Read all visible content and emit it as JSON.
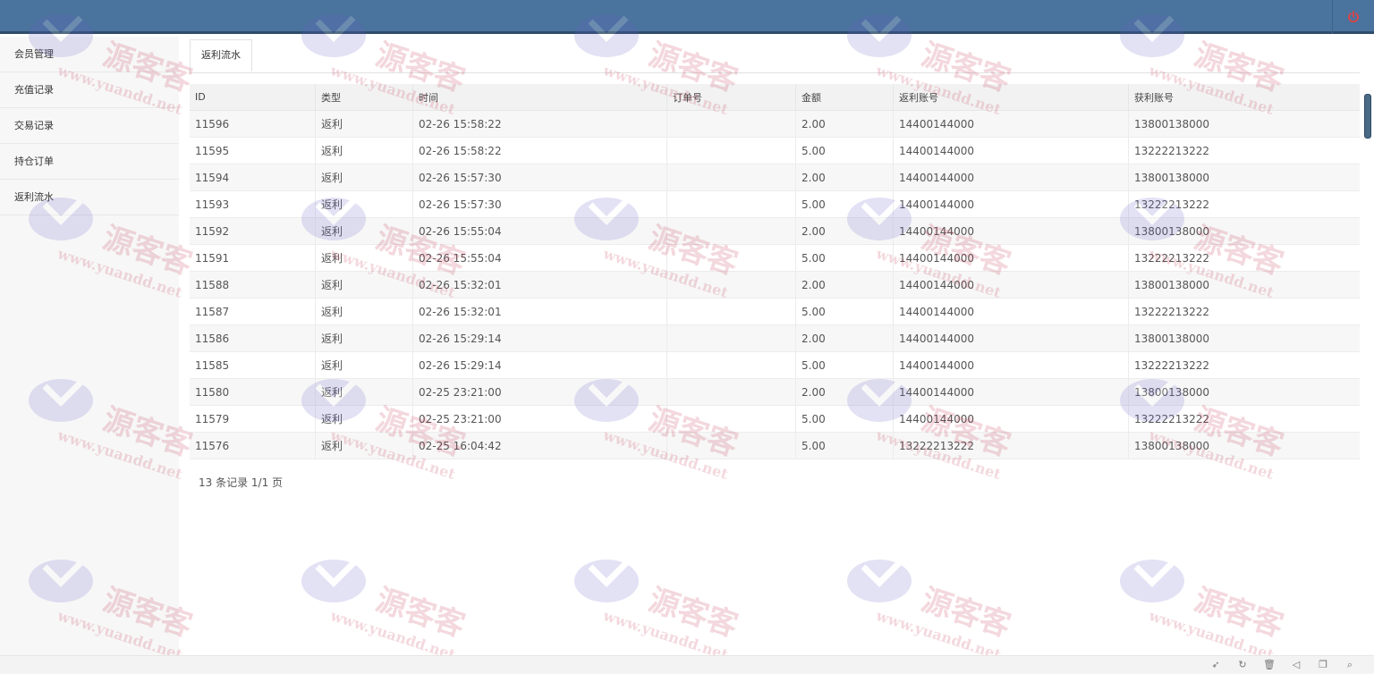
{
  "header": {
    "power_icon": "power-icon",
    "accent": "#4a739e"
  },
  "sidebar": {
    "items": [
      {
        "label": "会员管理"
      },
      {
        "label": "充值记录"
      },
      {
        "label": "交易记录"
      },
      {
        "label": "持仓订单"
      },
      {
        "label": "返利流水"
      }
    ]
  },
  "tabs": [
    {
      "label": "返利流水"
    }
  ],
  "table": {
    "columns": [
      "ID",
      "类型",
      "时间",
      "订单号",
      "金额",
      "返利账号",
      "获利账号"
    ],
    "rows": [
      {
        "id": "11596",
        "type": "返利",
        "time": "02-26 15:58:22",
        "order": "",
        "amount": "2.00",
        "rebate_account": "14400144000",
        "profit_account": "13800138000"
      },
      {
        "id": "11595",
        "type": "返利",
        "time": "02-26 15:58:22",
        "order": "",
        "amount": "5.00",
        "rebate_account": "14400144000",
        "profit_account": "13222213222"
      },
      {
        "id": "11594",
        "type": "返利",
        "time": "02-26 15:57:30",
        "order": "",
        "amount": "2.00",
        "rebate_account": "14400144000",
        "profit_account": "13800138000"
      },
      {
        "id": "11593",
        "type": "返利",
        "time": "02-26 15:57:30",
        "order": "",
        "amount": "5.00",
        "rebate_account": "14400144000",
        "profit_account": "13222213222"
      },
      {
        "id": "11592",
        "type": "返利",
        "time": "02-26 15:55:04",
        "order": "",
        "amount": "2.00",
        "rebate_account": "14400144000",
        "profit_account": "13800138000"
      },
      {
        "id": "11591",
        "type": "返利",
        "time": "02-26 15:55:04",
        "order": "",
        "amount": "5.00",
        "rebate_account": "14400144000",
        "profit_account": "13222213222"
      },
      {
        "id": "11588",
        "type": "返利",
        "time": "02-26 15:32:01",
        "order": "",
        "amount": "2.00",
        "rebate_account": "14400144000",
        "profit_account": "13800138000"
      },
      {
        "id": "11587",
        "type": "返利",
        "time": "02-26 15:32:01",
        "order": "",
        "amount": "5.00",
        "rebate_account": "14400144000",
        "profit_account": "13222213222"
      },
      {
        "id": "11586",
        "type": "返利",
        "time": "02-26 15:29:14",
        "order": "",
        "amount": "2.00",
        "rebate_account": "14400144000",
        "profit_account": "13800138000"
      },
      {
        "id": "11585",
        "type": "返利",
        "time": "02-26 15:29:14",
        "order": "",
        "amount": "5.00",
        "rebate_account": "14400144000",
        "profit_account": "13222213222"
      },
      {
        "id": "11580",
        "type": "返利",
        "time": "02-25 23:21:00",
        "order": "",
        "amount": "2.00",
        "rebate_account": "14400144000",
        "profit_account": "13800138000"
      },
      {
        "id": "11579",
        "type": "返利",
        "time": "02-25 23:21:00",
        "order": "",
        "amount": "5.00",
        "rebate_account": "14400144000",
        "profit_account": "13222213222"
      },
      {
        "id": "11576",
        "type": "返利",
        "time": "02-25 16:04:42",
        "order": "",
        "amount": "5.00",
        "rebate_account": "13222213222",
        "profit_account": "13800138000"
      }
    ]
  },
  "pager": {
    "text": "13 条记录 1/1 页"
  },
  "tray": {
    "icons": [
      "rocket-icon",
      "refresh-icon",
      "trash-icon",
      "speaker-icon",
      "window-icon",
      "search-icon"
    ]
  },
  "watermark": {
    "text_cn": "源客客",
    "text_url": "www.yuandd.net"
  }
}
